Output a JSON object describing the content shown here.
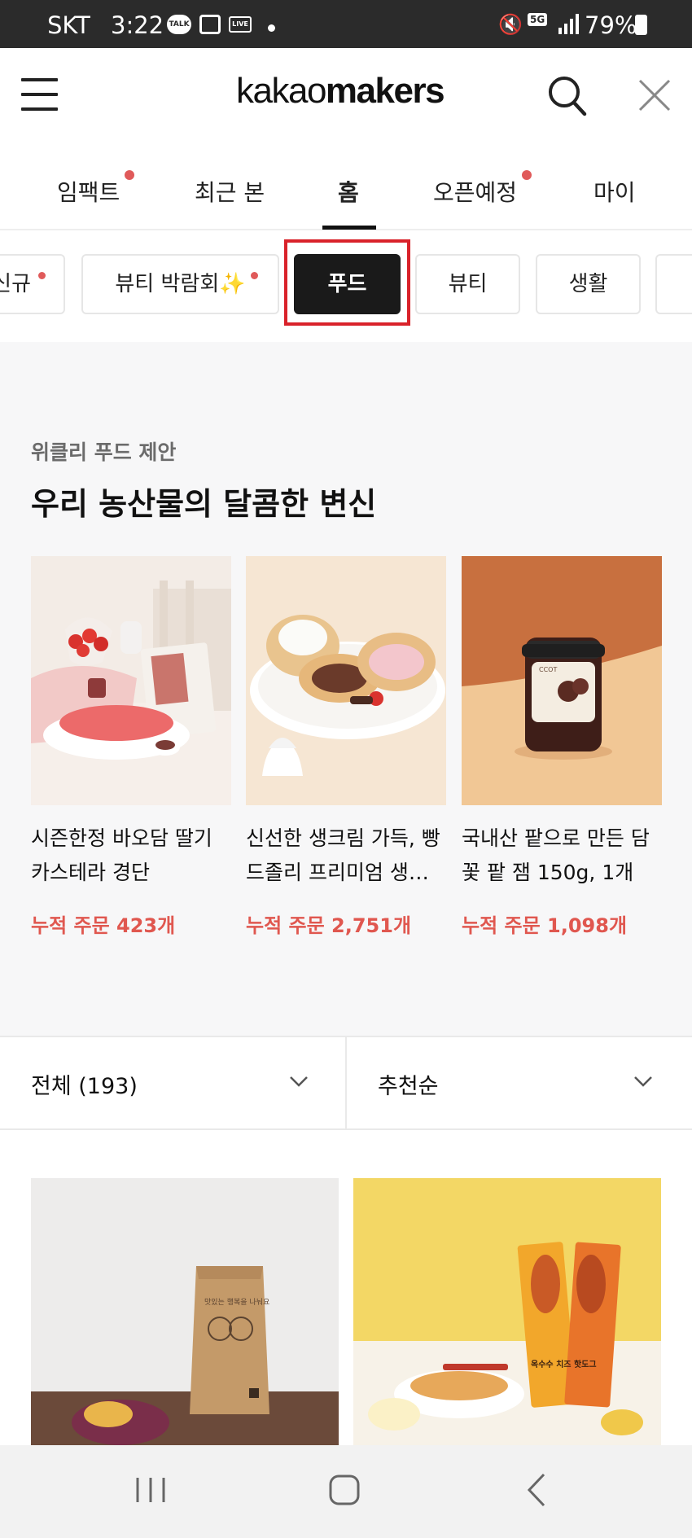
{
  "status_bar": {
    "carrier": "SKT",
    "time": "3:22",
    "talk_badge": "TALK",
    "live_badge": "LIVE",
    "network": "5G",
    "battery": "79%",
    "icons": [
      "kakaotalk-icon",
      "gallery-icon",
      "live-icon",
      "notification-dot-icon",
      "mute-icon",
      "5g-icon",
      "signal-icon",
      "battery-icon"
    ]
  },
  "header": {
    "logo_light": "kakao",
    "logo_bold": "makers",
    "icons": [
      "menu-icon",
      "search-icon",
      "close-icon"
    ]
  },
  "tabs": [
    {
      "label": "임팩트",
      "has_dot": true
    },
    {
      "label": "최근 본",
      "has_dot": false
    },
    {
      "label": "홈",
      "has_dot": false,
      "active": true
    },
    {
      "label": "오픈예정",
      "has_dot": true
    },
    {
      "label": "마이",
      "has_dot": false
    }
  ],
  "chips": [
    {
      "label": "신규",
      "has_dot": true
    },
    {
      "label": "뷰티 박람회✨",
      "has_dot": true
    },
    {
      "label": "푸드",
      "selected": true
    },
    {
      "label": "뷰티"
    },
    {
      "label": "생활"
    }
  ],
  "weekly": {
    "eyebrow": "위클리 푸드 제안",
    "title": "우리 농산물의 달콤한 변신",
    "products": [
      {
        "name": "시즌한정 바오담 딸기 카스테라 경단",
        "orders": "누적 주문 423개"
      },
      {
        "name": "신선한 생크림 가득, 빵드졸리 프리미엄 생…",
        "orders": "누적 주문 2,751개"
      },
      {
        "name": "국내산 팥으로 만든 담꽃 팥 잼 150g, 1개",
        "orders": "누적 주문 1,098개"
      }
    ]
  },
  "filters": {
    "category": "전체 (193)",
    "sort": "추천순"
  },
  "product_images": {
    "left_bag_text": "맛있는 행복을 나눠요",
    "right_pack_text": "옥수수 치즈 핫도그"
  },
  "colors": {
    "accent_red": "#e05a5a",
    "order_red": "#e0574f",
    "highlight_red": "#d9222a",
    "selected_chip": "#1a1a1a"
  }
}
